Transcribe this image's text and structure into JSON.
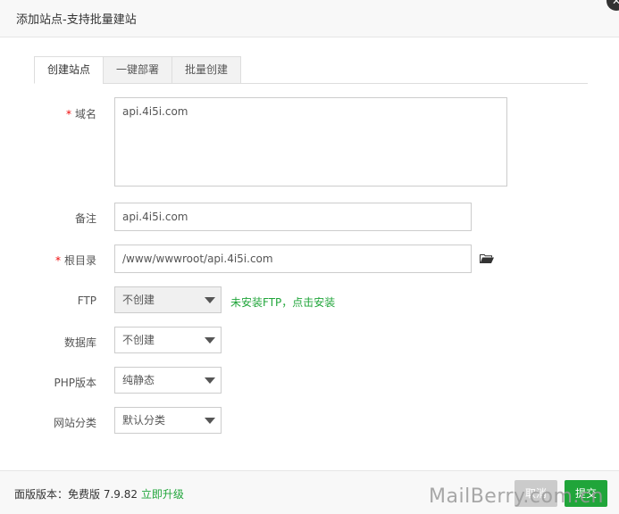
{
  "window": {
    "title": "添加站点-支持批量建站",
    "close_icon": "close-icon"
  },
  "tabs": [
    {
      "label": "创建站点",
      "active": true
    },
    {
      "label": "一键部署",
      "active": false
    },
    {
      "label": "批量创建",
      "active": false
    }
  ],
  "form": {
    "domain": {
      "label": "域名",
      "required": true,
      "value": "api.4i5i.com"
    },
    "remark": {
      "label": "备注",
      "value": "api.4i5i.com"
    },
    "root": {
      "label": "根目录",
      "required": true,
      "value": "/www/wwwroot/api.4i5i.com",
      "icon": "folder-open-icon"
    },
    "ftp": {
      "label": "FTP",
      "selected": "不创建",
      "hint": "未安装FTP，点击安装"
    },
    "database": {
      "label": "数据库",
      "selected": "不创建"
    },
    "php": {
      "label": "PHP版本",
      "selected": "纯静态"
    },
    "category": {
      "label": "网站分类",
      "selected": "默认分类"
    }
  },
  "footer": {
    "version_label": "面版版本：免费版 7.9.82",
    "upgrade_link": "立即升级",
    "cancel_label": "取消",
    "submit_label": "提交"
  },
  "watermark": "MailBerry.com.cn",
  "colors": {
    "accent": "#20a53a",
    "required": "#ef0808",
    "cancel": "#cbcbcb"
  }
}
